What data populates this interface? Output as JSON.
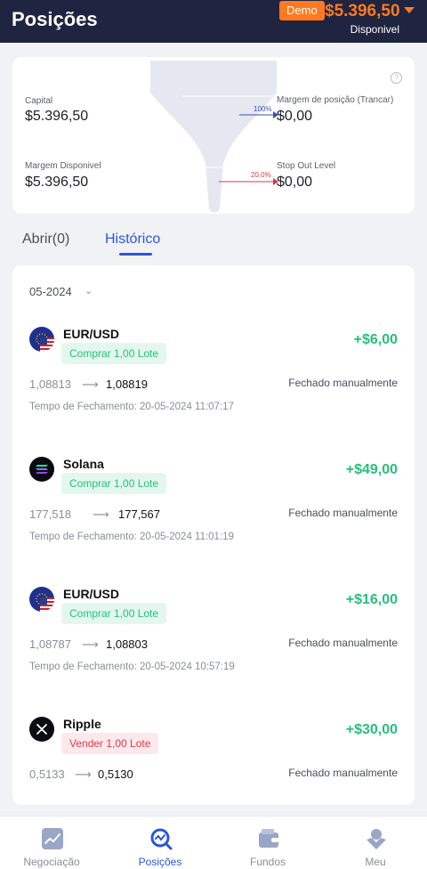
{
  "header": {
    "title": "Posições",
    "account_badge": "Demo",
    "balance": "$5.396,50",
    "balance_caption": "Disponivel"
  },
  "summary": {
    "capital_label": "Capital",
    "capital_value": "$5.396,50",
    "margin_available_label": "Margem Disponivel",
    "margin_available_value": "$5.396,50",
    "position_margin_label": "Margem de posição (Trancar)",
    "position_margin_value": "$0,00",
    "position_margin_pct": "100%",
    "stop_out_label": "Stop Out Level",
    "stop_out_value": "$0,00",
    "stop_out_pct": "20.0%"
  },
  "tabs": {
    "open": "Abrir(0)",
    "history": "Histórico"
  },
  "history": {
    "month": "05-2024",
    "trades": [
      {
        "symbol": "EUR/USD",
        "side": "Comprar 1,00 Lote",
        "side_type": "buy",
        "pnl": "+$6,00",
        "open_price": "1,08813",
        "close_price": "1,08819",
        "status": "Fechado manualmente",
        "close_time": "Tempo de Fechamento: 20-05-2024 11:07:17"
      },
      {
        "symbol": "Solana",
        "side": "Comprar 1,00 Lote",
        "side_type": "buy",
        "pnl": "+$49,00",
        "open_price": "177,518",
        "close_price": "177,567",
        "status": "Fechado manualmente",
        "close_time": "Tempo de Fechamento: 20-05-2024 11:01:19"
      },
      {
        "symbol": "EUR/USD",
        "side": "Comprar 1,00 Lote",
        "side_type": "buy",
        "pnl": "+$16,00",
        "open_price": "1,08787",
        "close_price": "1,08803",
        "status": "Fechado manualmente",
        "close_time": "Tempo de Fechamento: 20-05-2024 10:57:19"
      },
      {
        "symbol": "Ripple",
        "side": "Vender 1,00 Lote",
        "side_type": "sell",
        "pnl": "+$30,00",
        "open_price": "0,5133",
        "close_price": "0,5130",
        "status": "Fechado manualmente",
        "close_time": ""
      }
    ]
  },
  "nav": {
    "trading": "Negociação",
    "positions": "Posições",
    "funds": "Fundos",
    "me": "Meu"
  },
  "colors": {
    "accent": "#2b56d6",
    "brand_orange": "#ff7a21",
    "profit_green": "#27c07a",
    "sell_red": "#e03a4f",
    "header_bg": "#1f2440"
  }
}
